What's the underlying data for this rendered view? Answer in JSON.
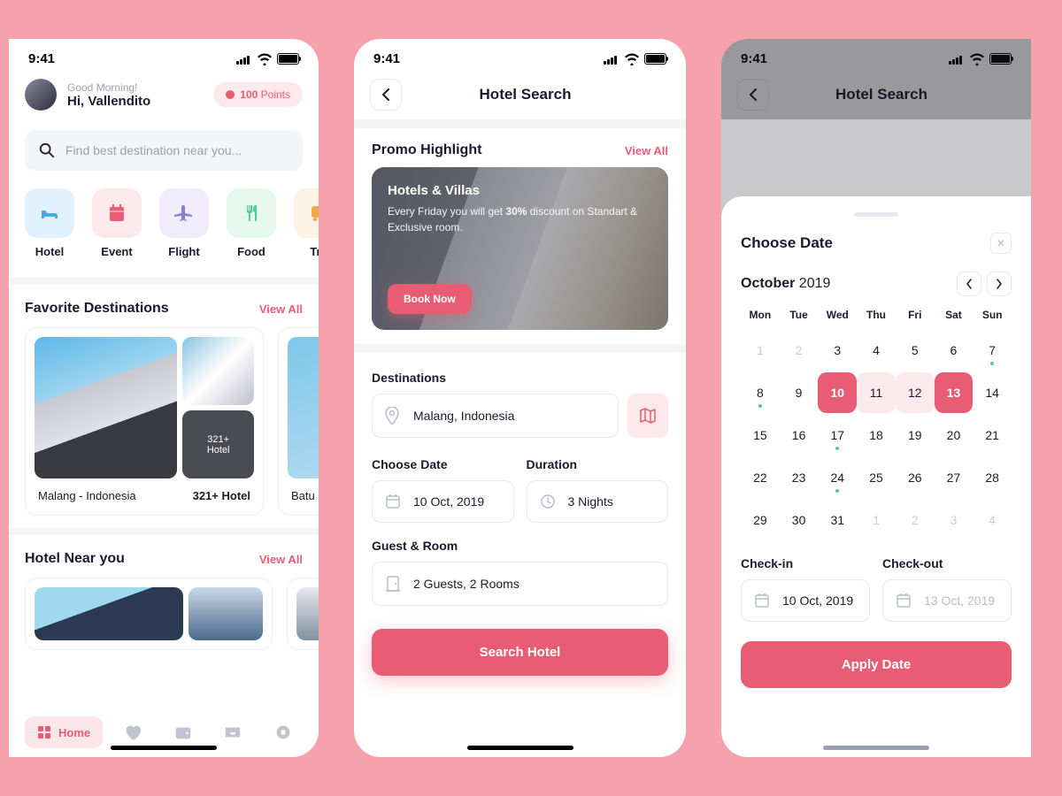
{
  "status_time": "9:41",
  "s1": {
    "greeting": "Good Morning!",
    "username": "Hi, Vallendito",
    "points_num": "100",
    "points_label": " Points",
    "search_placeholder": "Find best destination near you...",
    "cats": [
      {
        "label": "Hotel",
        "bg": "#e1f2fe",
        "fg": "#4aa8e8"
      },
      {
        "label": "Event",
        "bg": "#fde8eb",
        "fg": "#e95d74"
      },
      {
        "label": "Flight",
        "bg": "#f0ecfb",
        "fg": "#8a7fd0"
      },
      {
        "label": "Food",
        "bg": "#e6f7ee",
        "fg": "#4fd18b"
      },
      {
        "label": "Tra",
        "bg": "#fdf3e5",
        "fg": "#f0a94a"
      }
    ],
    "fav_title": "Favorite Destinations",
    "view_all": "View All",
    "dest": {
      "badge1": "321+",
      "badge2": "Hotel",
      "name": "Malang - Indonesia",
      "count": "321+ Hotel",
      "name2": "Batu -"
    },
    "near_title": "Hotel Near you",
    "nav_home": "Home"
  },
  "s2": {
    "title": "Hotel Search",
    "promo_head": "Promo Highlight",
    "view_all": "View All",
    "promo_title": "Hotels & Villas",
    "promo_desc1": "Every Friday you will get ",
    "promo_pct": "30%",
    "promo_desc2": " discount on Standart & Exclusive room.",
    "book": "Book Now",
    "dest_label": "Destinations",
    "dest_value": "Malang, Indonesia",
    "date_label": "Choose Date",
    "date_value": "10 Oct, 2019",
    "dur_label": "Duration",
    "dur_value": "3 Nights",
    "guest_label": "Guest & Room",
    "guest_value": "2 Guests, 2 Rooms",
    "search_btn": "Search Hotel"
  },
  "s3": {
    "title": "Hotel Search",
    "sheet_title": "Choose Date",
    "month": "October",
    "year": "2019",
    "dow": [
      "Mon",
      "Tue",
      "Wed",
      "Thu",
      "Fri",
      "Sat",
      "Sun"
    ],
    "weeks": [
      [
        {
          "d": "1",
          "m": 1
        },
        {
          "d": "2",
          "m": 1
        },
        {
          "d": "3"
        },
        {
          "d": "4"
        },
        {
          "d": "5"
        },
        {
          "d": "6"
        },
        {
          "d": "7",
          "g": 1
        }
      ],
      [
        {
          "d": "8",
          "g": 1
        },
        {
          "d": "9"
        },
        {
          "d": "10",
          "s": 1
        },
        {
          "d": "11",
          "r": 1
        },
        {
          "d": "12",
          "r": 1
        },
        {
          "d": "13",
          "s": 1
        },
        {
          "d": "14"
        }
      ],
      [
        {
          "d": "15"
        },
        {
          "d": "16"
        },
        {
          "d": "17",
          "g": 1
        },
        {
          "d": "18"
        },
        {
          "d": "19"
        },
        {
          "d": "20"
        },
        {
          "d": "21"
        }
      ],
      [
        {
          "d": "22"
        },
        {
          "d": "23"
        },
        {
          "d": "24",
          "g": 1
        },
        {
          "d": "25"
        },
        {
          "d": "26"
        },
        {
          "d": "27"
        },
        {
          "d": "28"
        }
      ],
      [
        {
          "d": "29"
        },
        {
          "d": "30"
        },
        {
          "d": "31"
        },
        {
          "d": "1",
          "m": 1
        },
        {
          "d": "2",
          "m": 1
        },
        {
          "d": "3",
          "m": 1
        },
        {
          "d": "4",
          "m": 1
        }
      ]
    ],
    "ci_label": "Check-in",
    "ci_value": "10 Oct, 2019",
    "co_label": "Check-out",
    "co_value": "13 Oct, 2019",
    "apply": "Apply Date"
  }
}
